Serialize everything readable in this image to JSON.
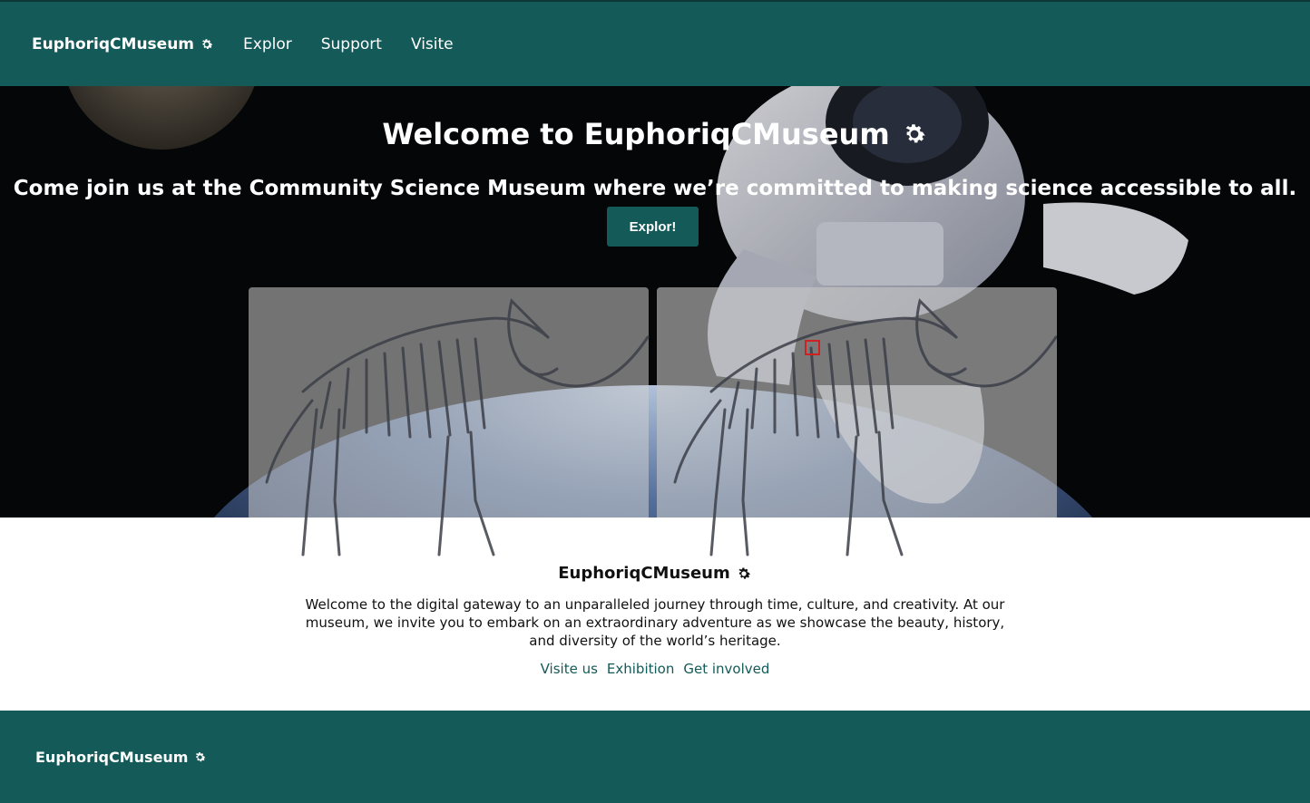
{
  "nav": {
    "brand": "EuphoriqCMuseum",
    "brand_icon": "gear-icon",
    "links": [
      "Explor",
      "Support",
      "Visite"
    ]
  },
  "hero": {
    "title": "Welcome to EuphoriqCMuseum",
    "title_icon": "gear-icon",
    "subtitle": "Come join us at the Community Science Museum where we’re committed to making science accessible to all.",
    "button_label": "Explor!"
  },
  "content": {
    "title": "EuphoriqCMuseum",
    "description": "Welcome to the digital gateway to an unparalleled journey through time, culture, and creativity. At our museum, we invite you to embark on an extraordinary adventure as we showcase the beauty, history, and diversity of the world’s heritage.",
    "links": [
      "Visite us",
      "Exhibition",
      "Get involved"
    ]
  },
  "footer": {
    "brand": "EuphoriqCMuseum"
  },
  "colors": {
    "primary": "#135a58",
    "text": "#111111",
    "hero_bg": "#050608"
  }
}
